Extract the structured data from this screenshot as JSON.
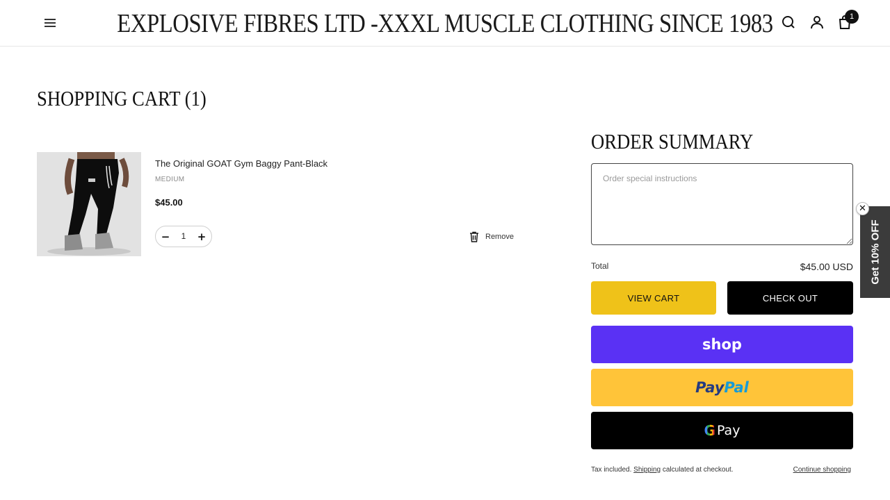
{
  "header": {
    "title": "EXPLOSIVE FIBRES LTD -XXXL MUSCLE CLOTHING SINCE 1983",
    "cart_count": "1",
    "icons": [
      "menu-icon",
      "search-icon",
      "account-icon",
      "cart-icon"
    ]
  },
  "cart": {
    "title": "SHOPPING CART (1)",
    "items": [
      {
        "name": "The Original GOAT Gym Baggy Pant-Black",
        "variant": "MEDIUM",
        "price": "$45.00",
        "quantity": "1",
        "remove_label": "Remove"
      }
    ]
  },
  "summary": {
    "title": "ORDER SUMMARY",
    "instructions_placeholder": "Order special instructions",
    "total_label": "Total",
    "total_value": "$45.00 USD",
    "view_cart_label": "VIEW CART",
    "checkout_label": "CHECK OUT",
    "shop_pay_label": "shop",
    "paypal_label_1": "Pay",
    "paypal_label_2": "Pal",
    "gpay_label": "Pay",
    "gpay_g": "G",
    "footnote_prefix": "Tax included.",
    "footnote_link": "Shipping",
    "footnote_suffix": "calculated at checkout.",
    "continue_label": "Continue shopping"
  },
  "promo": {
    "label": "Get 10% OFF",
    "close": "✕"
  },
  "colors": {
    "view_cart_bg": "#efc219",
    "shop_pay_bg": "#5a31f4",
    "paypal_bg": "#ffc439",
    "gpay_bg": "#000000",
    "promo_bg": "#3b3b3b"
  }
}
